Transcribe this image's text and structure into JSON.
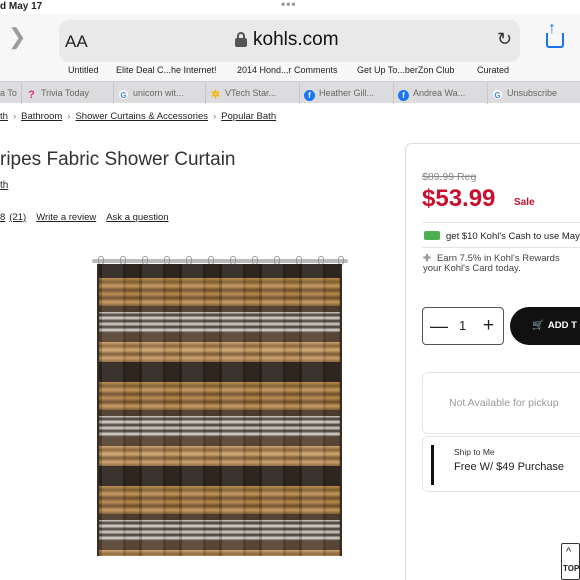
{
  "status": {
    "time": "d May 17",
    "dots": "•••"
  },
  "browser": {
    "text_size_label": "A",
    "text_size_label_big": "A",
    "url": "kohls.com",
    "favorites": [
      "Untitled",
      "Elite Deal C...he Internet!",
      "2014 Hond...r Comments",
      "Get Up To...berZon Club",
      "Curated"
    ],
    "tabs": [
      {
        "label": "a To",
        "icon": ""
      },
      {
        "label": "Trivia Today",
        "icon": "?"
      },
      {
        "label": "unicorn wit...",
        "icon": "G"
      },
      {
        "label": "VTech Star...",
        "icon": "✲"
      },
      {
        "label": "Heather Gill...",
        "icon": "f"
      },
      {
        "label": "Andrea Wa...",
        "icon": "f"
      },
      {
        "label": "Unsubscribe",
        "icon": "G"
      }
    ]
  },
  "breadcrumb": [
    "th",
    "Bathroom",
    "Shower Curtains & Accessories",
    "Popular Bath"
  ],
  "product": {
    "title": "ripes Fabric Shower Curtain",
    "brand": "th",
    "rating_fragment": "8",
    "review_count": "(21)",
    "write_review": "Write a review",
    "ask_question": "Ask a question"
  },
  "pricing": {
    "regular": "$89.99 Reg",
    "sale_price": "$53.99",
    "sale_label": "Sale",
    "kohls_cash": "get $10 Kohl's Cash to use May",
    "rewards_line1": "Earn 7.5% in Kohl's Rewards",
    "rewards_line2": "your Kohl's Card today."
  },
  "cart": {
    "minus": "—",
    "quantity": "1",
    "plus": "+",
    "add_label": "ADD T",
    "pickup": "Not Available for pickup",
    "ship_title": "Ship to Me",
    "ship_sub": "Free W/ $49 Purchase"
  },
  "top_button": {
    "caret": "^",
    "label": "TOP"
  }
}
